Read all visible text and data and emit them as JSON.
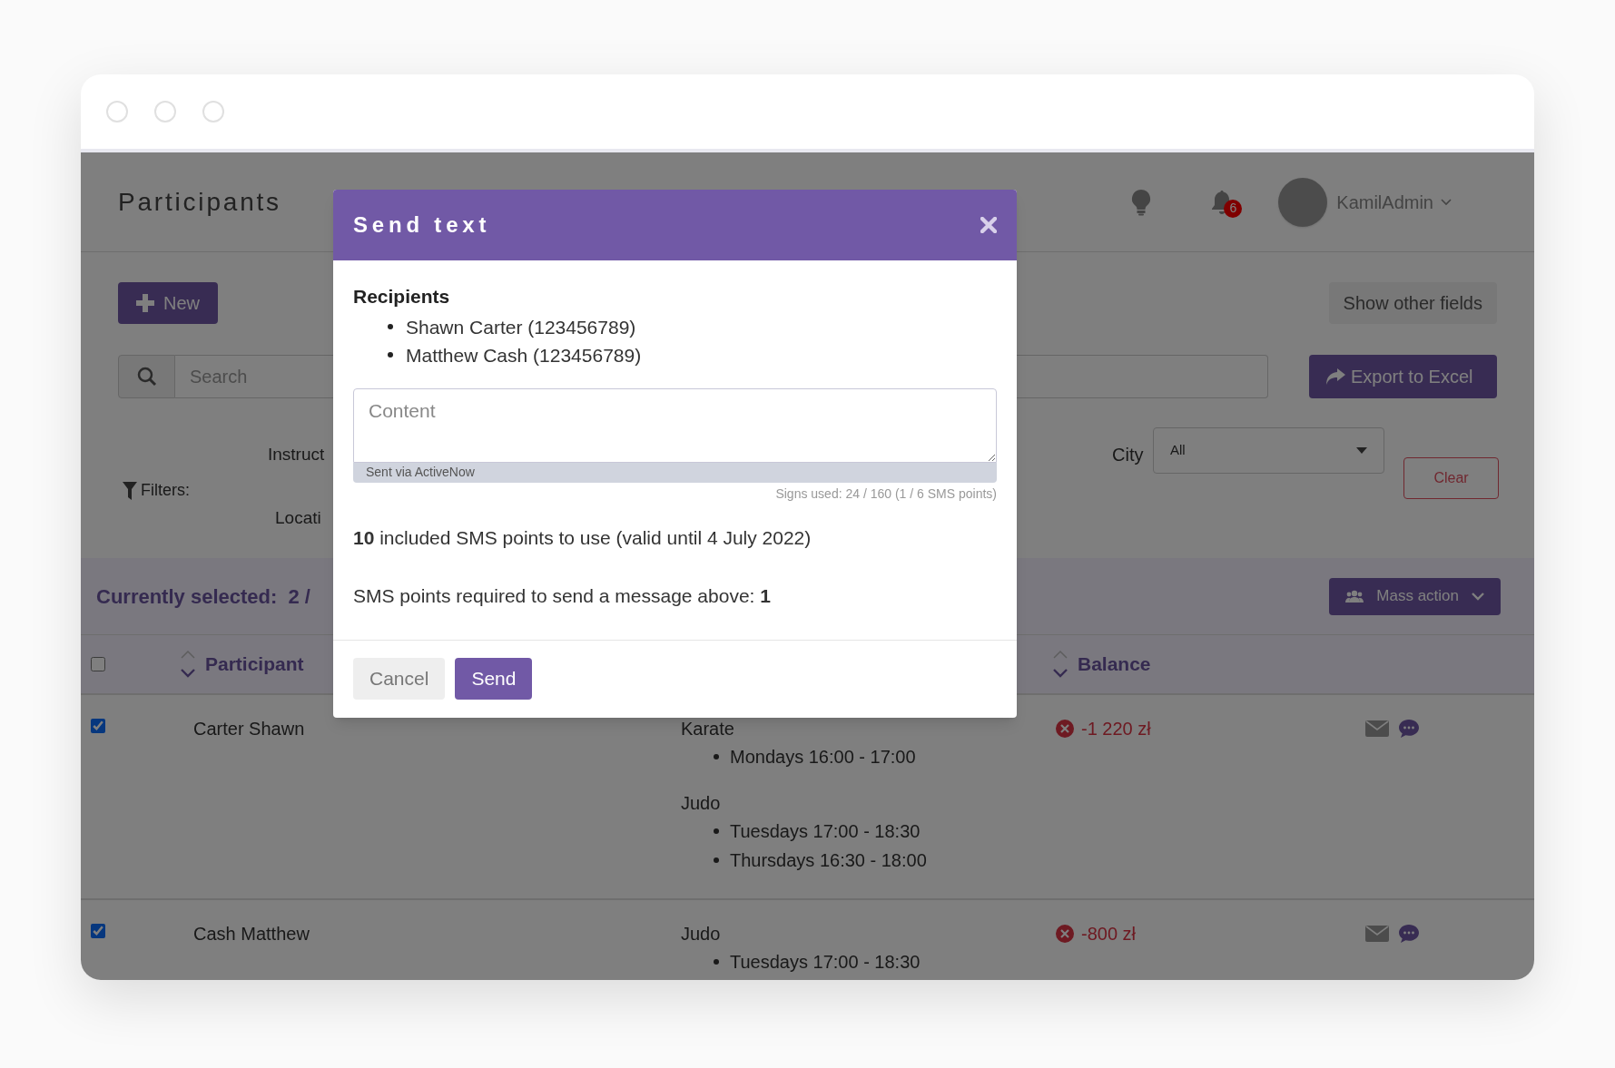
{
  "header": {
    "title": "Participants",
    "notifications": "6",
    "user": "KamilAdmin"
  },
  "toolbar": {
    "new_button": "New",
    "show_fields_button": "Show other fields",
    "search": {
      "placeholder": "Search"
    },
    "export_button": "Export to Excel"
  },
  "filters": {
    "label": "Filters:",
    "instructor_label": "Instruct",
    "location_label": "Locati",
    "city": {
      "label": "City",
      "value": "All"
    },
    "clear_button": "Clear"
  },
  "selection": {
    "text": "Currently selected:  2 /",
    "mass_action_button": "Mass action"
  },
  "table": {
    "select_all_checked": false,
    "columns": [
      "Participant",
      "Balance"
    ],
    "rows": [
      {
        "checked": true,
        "name": "Carter Shawn",
        "activities": [
          {
            "name": "Karate",
            "times": [
              "Mondays 16:00 - 17:00"
            ]
          },
          {
            "name": "Judo",
            "times": [
              "Tuesdays 17:00 - 18:30",
              "Thursdays 16:30 - 18:00"
            ]
          }
        ],
        "balance": "-1 220 zł"
      },
      {
        "checked": true,
        "name": "Cash Matthew",
        "activities": [
          {
            "name": "Judo",
            "times": [
              "Tuesdays 17:00 - 18:30"
            ]
          }
        ],
        "balance": "-800 zł"
      }
    ]
  },
  "modal": {
    "title": "Send text",
    "recipients_label": "Recipients",
    "recipients": [
      "Shawn Carter (123456789)",
      "Matthew Cash (123456789)"
    ],
    "content": {
      "placeholder": "Content"
    },
    "footer_note": "Sent via ActiveNow",
    "counter": "Signs used: 24 / 160 (1 / 6 SMS points)",
    "points_info": "**10** included SMS points to use (valid until 4 July 2022)",
    "required_info": "SMS points required to send a message above: **1**",
    "buttons": [
      {
        "label": "Cancel",
        "kind": "secondary"
      },
      {
        "label": "Send",
        "kind": "primary"
      }
    ]
  }
}
